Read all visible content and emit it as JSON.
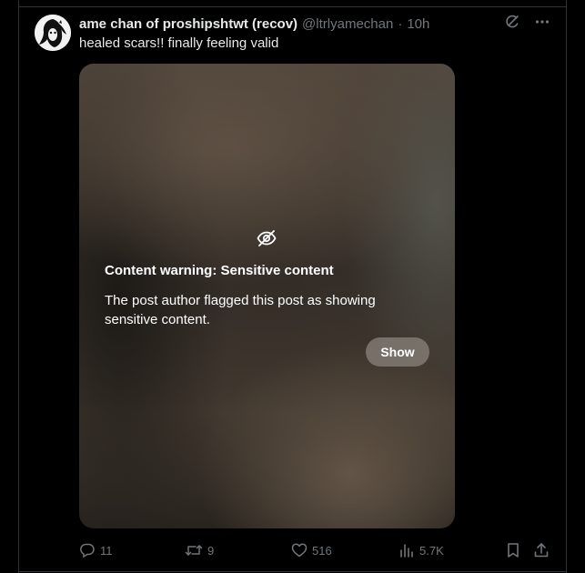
{
  "post": {
    "display_name": "ame chan of proshipshtwt (recov)",
    "handle": "@ltrlyamechan",
    "separator": "·",
    "time": "10h",
    "text": "healed scars!! finally feeling valid",
    "avatar_icon": "avatar-image"
  },
  "header_icons": [
    "grok-icon",
    "more-icon"
  ],
  "media": {
    "warning_icon": "eye-slash-icon",
    "warning_title": "Content warning: Sensitive content",
    "warning_body": "The post author flagged this post as showing sensitive content.",
    "show_label": "Show"
  },
  "actions": {
    "replies": "11",
    "reposts": "9",
    "likes": "516",
    "views": "5.7K",
    "icons": [
      "reply-icon",
      "repost-icon",
      "like-icon",
      "views-icon",
      "bookmark-icon",
      "share-icon"
    ]
  },
  "colors": {
    "background": "#000000",
    "text": "#e7e9ea",
    "muted": "#71767b",
    "border": "#2f3336"
  }
}
